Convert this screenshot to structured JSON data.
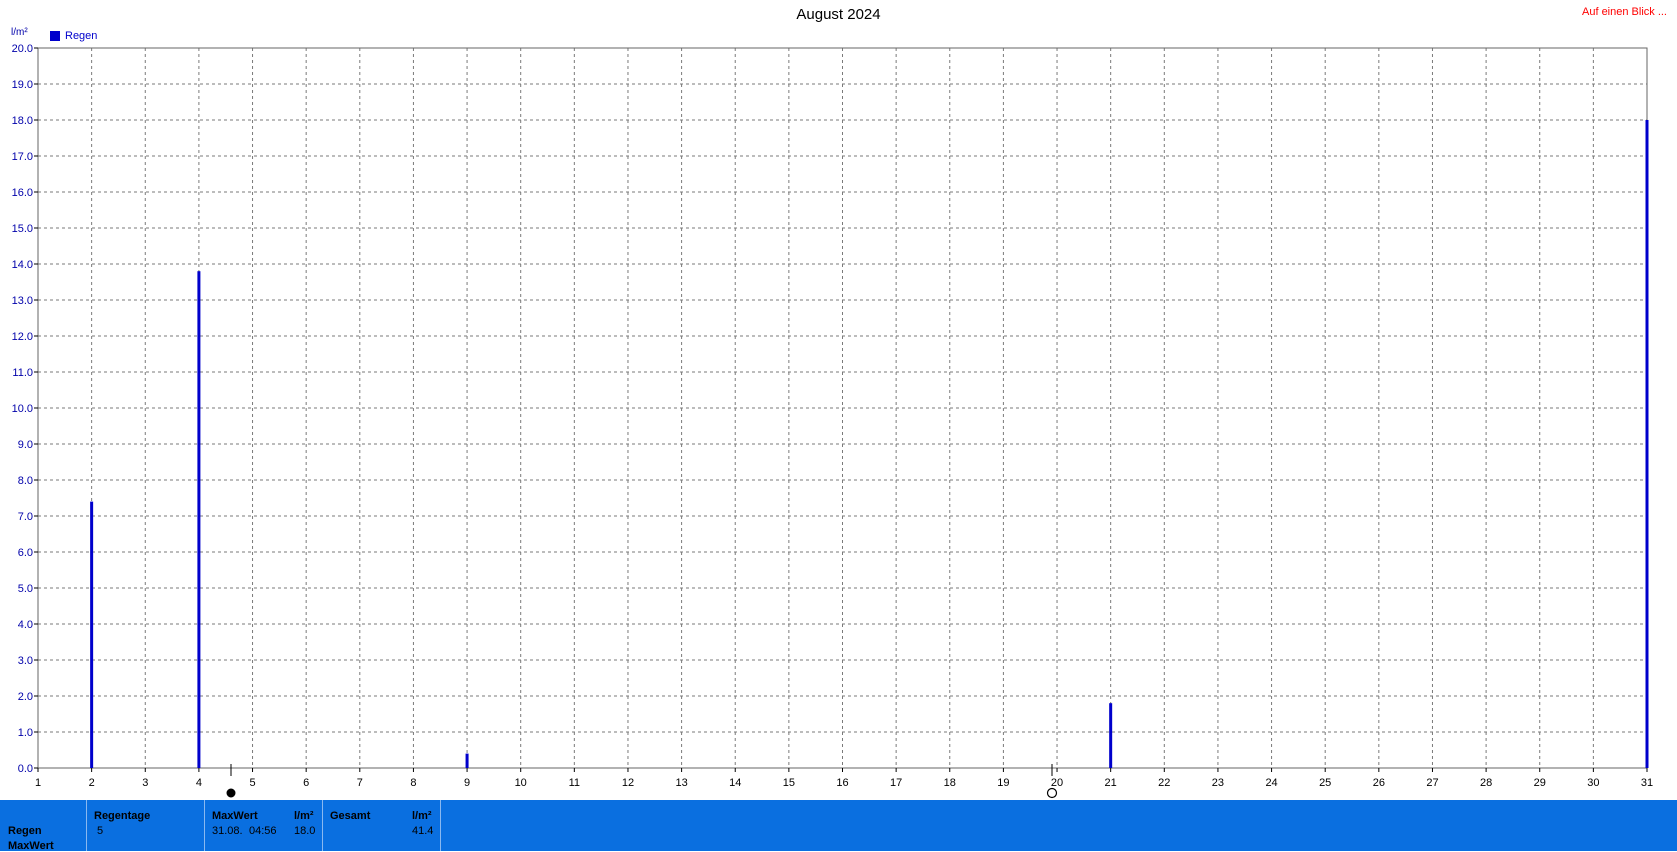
{
  "header": {
    "title": "August 2024",
    "overview_link": "Auf einen Blick ...",
    "unit": "l/m²"
  },
  "legend": {
    "label": "Regen",
    "color": "#0000cc"
  },
  "chart_data": {
    "type": "bar",
    "title": "August 2024",
    "ylabel": "l/m²",
    "xlabel": "",
    "ylim": [
      0,
      20
    ],
    "y_ticks": [
      "0.0",
      "1.0",
      "2.0",
      "3.0",
      "4.0",
      "5.0",
      "6.0",
      "7.0",
      "8.0",
      "9.0",
      "10.0",
      "11.0",
      "12.0",
      "13.0",
      "14.0",
      "15.0",
      "16.0",
      "17.0",
      "18.0",
      "19.0",
      "20.0"
    ],
    "x_ticks": [
      "1",
      "2",
      "3",
      "4",
      "5",
      "6",
      "7",
      "8",
      "9",
      "10",
      "11",
      "12",
      "13",
      "14",
      "15",
      "16",
      "17",
      "18",
      "19",
      "20",
      "21",
      "22",
      "23",
      "24",
      "25",
      "26",
      "27",
      "28",
      "29",
      "30",
      "31"
    ],
    "xlim": [
      1,
      31
    ],
    "grid": true,
    "legend_position": "top-left",
    "series": [
      {
        "name": "Regen",
        "color": "#0000cc",
        "points": [
          {
            "x": 2,
            "y": 7.4
          },
          {
            "x": 4,
            "y": 13.8
          },
          {
            "x": 9,
            "y": 0.4
          },
          {
            "x": 21,
            "y": 1.8
          },
          {
            "x": 31,
            "y": 18.0
          }
        ]
      }
    ]
  },
  "footer": {
    "row_labels": [
      "Regen",
      "MaxWert"
    ],
    "regentage": {
      "header": "Regentage",
      "value": "5"
    },
    "maxwert": {
      "header": "MaxWert",
      "unit": "l/m²",
      "date": "31.08.",
      "time": "04:56",
      "value": "18.0"
    },
    "gesamt": {
      "header": "Gesamt",
      "unit": "l/m²",
      "value": "41.4"
    }
  }
}
